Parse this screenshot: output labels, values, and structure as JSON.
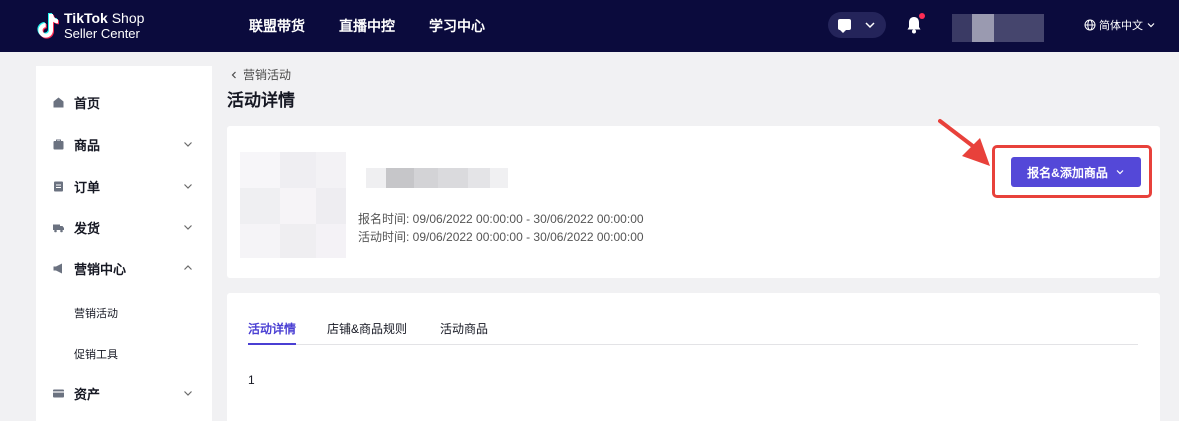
{
  "header": {
    "logo_line1_brand": "TikTok",
    "logo_line1_rest": " Shop",
    "logo_line2": "Seller Center",
    "nav": [
      "联盟带货",
      "直播中控",
      "学习中心"
    ],
    "language": "简体中文",
    "icons": [
      "chat-icon",
      "bell-icon",
      "globe-icon"
    ],
    "colors": {
      "background": "#0b0b3d",
      "notification_dot": "#fe2c55"
    }
  },
  "sidebar": {
    "items": [
      {
        "label": "首页",
        "icon": "home-icon"
      },
      {
        "label": "商品",
        "icon": "product-icon"
      },
      {
        "label": "订单",
        "icon": "order-icon"
      },
      {
        "label": "发货",
        "icon": "truck-icon"
      },
      {
        "label": "营销中心",
        "icon": "megaphone-icon"
      },
      {
        "label": "资产",
        "icon": "card-icon"
      }
    ],
    "sub_items": [
      "营销活动",
      "促销工具"
    ]
  },
  "breadcrumb": {
    "back_label": "营销活动"
  },
  "page": {
    "title": "活动详情"
  },
  "campaign": {
    "registration_time": "报名时间: 09/06/2022 00:00:00 - 30/06/2022 00:00:00",
    "activity_time": "活动时间: 09/06/2022 00:00:00 - 30/06/2022 00:00:00",
    "cta_label": "报名&添加商品",
    "colors": {
      "primary": "#5448d8",
      "highlight": "#e8413b"
    }
  },
  "tabs": {
    "items": [
      "活动详情",
      "店铺&商品规则",
      "活动商品"
    ],
    "active": "活动详情"
  },
  "content": {
    "text": "1"
  }
}
